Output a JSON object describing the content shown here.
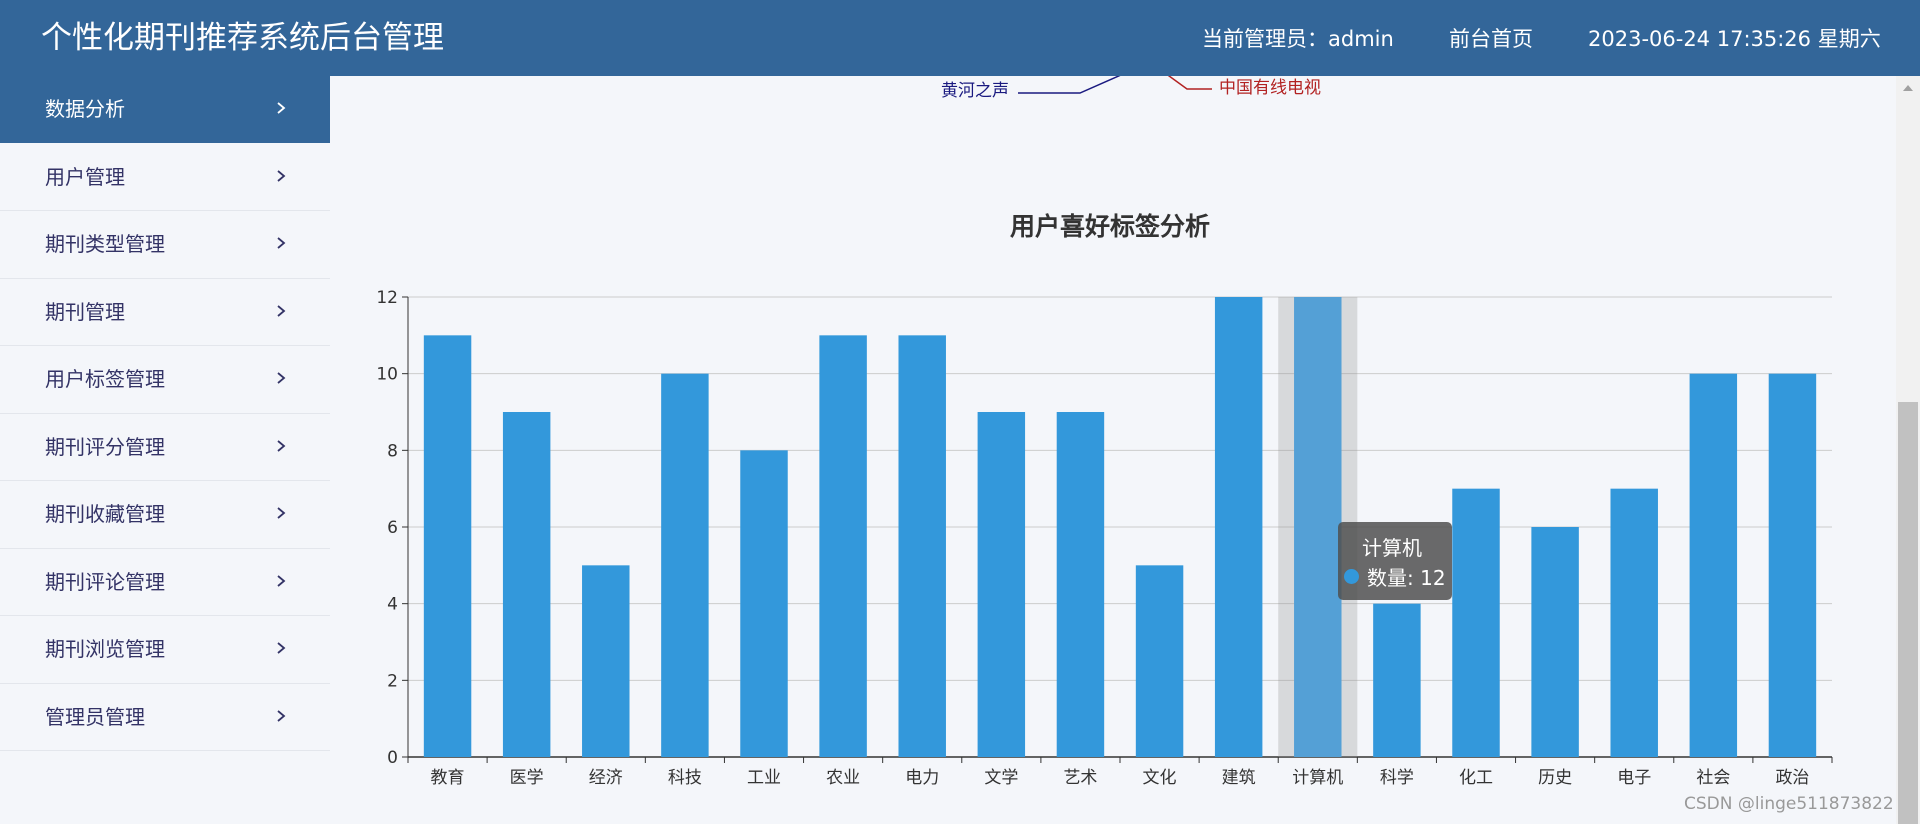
{
  "header": {
    "title": "个性化期刊推荐系统后台管理",
    "admin_label": "当前管理员：admin",
    "home_link": "前台首页",
    "datetime": "2023-06-24  17:35:26  星期六"
  },
  "sidebar": {
    "items": [
      {
        "label": "数据分析"
      },
      {
        "label": "用户管理"
      },
      {
        "label": "期刊类型管理"
      },
      {
        "label": "期刊管理"
      },
      {
        "label": "用户标签管理"
      },
      {
        "label": "期刊评分管理"
      },
      {
        "label": "期刊收藏管理"
      },
      {
        "label": "期刊评论管理"
      },
      {
        "label": "期刊浏览管理"
      },
      {
        "label": "管理员管理"
      }
    ]
  },
  "partial_chart": {
    "label_left": "黄河之声",
    "label_right": "中国有线电视",
    "label_left_color": "#1a1a80",
    "label_right_color": "#b22222"
  },
  "chart_data": {
    "type": "bar",
    "title": "用户喜好标签分析",
    "categories": [
      "教育",
      "医学",
      "经济",
      "科技",
      "工业",
      "农业",
      "电力",
      "文学",
      "艺术",
      "文化",
      "建筑",
      "计算机",
      "科学",
      "化工",
      "历史",
      "电子",
      "社会",
      "政治"
    ],
    "series": [
      {
        "values": [
          11,
          9,
          5,
          10,
          8,
          11,
          11,
          9,
          9,
          5,
          12,
          12,
          4,
          7,
          6,
          7,
          10,
          10
        ]
      }
    ],
    "ylim": [
      0,
      12
    ],
    "yticks": [
      0,
      2,
      4,
      6,
      8,
      10,
      12
    ],
    "grid": true,
    "bar_color": "#3398DB",
    "highlight_color": "#54A0D6",
    "highlight_index": 11
  },
  "tooltip": {
    "title": "计算机",
    "value_text": "数量: 12"
  },
  "watermark": "CSDN @linge511873822"
}
